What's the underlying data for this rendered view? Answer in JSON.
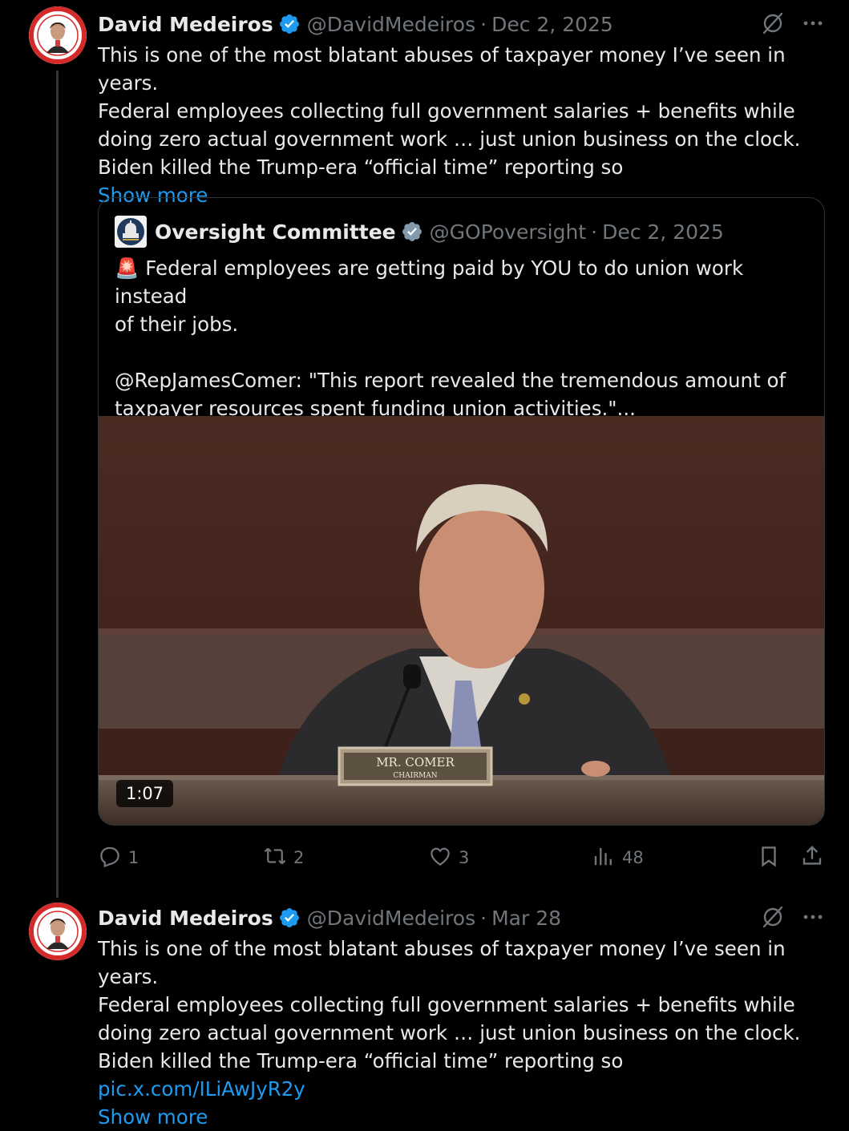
{
  "tweets": [
    {
      "author": "David Medeiros",
      "handle": "@DavidMedeiros",
      "separator": "·",
      "date": "Dec 2, 2025",
      "lines": [
        "This is one of the most blatant abuses of taxpayer money I’ve seen in years.",
        "Federal employees collecting full government salaries + benefits while",
        "doing zero actual government work … just union business on the clock.",
        "Biden killed the Trump-era “official time” reporting so"
      ],
      "show_more": "Show more",
      "quote": {
        "author": "Oversight Committee",
        "handle": "@GOPoversight",
        "separator": "·",
        "date": "Dec 2, 2025",
        "line1": "🚨 Federal employees are getting paid by YOU to do union work instead",
        "line2": "of their jobs.",
        "line3": "@RepJamesComer: \"This report revealed the tremendous amount of",
        "line4": "taxpayer resources spent funding union activities.\"...",
        "video": {
          "duration": "1:07",
          "nameplate_line1": "MR. COMER",
          "nameplate_line2": "CHAIRMAN"
        }
      },
      "actions": {
        "replies": "1",
        "reposts": "2",
        "likes": "3",
        "views": "48"
      }
    },
    {
      "author": "David Medeiros",
      "handle": "@DavidMedeiros",
      "separator": "·",
      "date": "Mar 28",
      "lines": [
        "This is one of the most blatant abuses of taxpayer money I’ve seen in years.",
        "Federal employees collecting full government salaries + benefits while",
        "doing zero actual government work … just union business on the clock.",
        "Biden killed the Trump-era “official time” reporting so"
      ],
      "link": "pic.x.com/ILiAwJyR2y",
      "show_more": "Show more"
    }
  ],
  "colors": {
    "background": "#000000",
    "text": "#e7e9ea",
    "muted": "#71767b",
    "accent": "#1d9bf0",
    "border": "#2f3336"
  },
  "icons": [
    "verified-badge-icon",
    "grok-icon",
    "more-icon",
    "reply-icon",
    "repost-icon",
    "like-icon",
    "views-icon",
    "bookmark-icon",
    "share-icon"
  ]
}
